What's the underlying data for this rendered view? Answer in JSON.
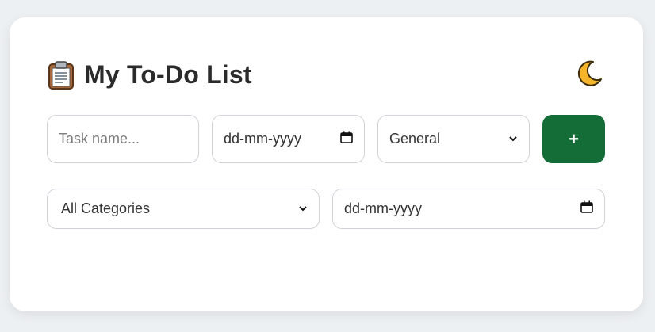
{
  "header": {
    "title": "My To-Do List",
    "title_icon": "clipboard-icon",
    "theme_toggle_icon": "crescent-moon-icon"
  },
  "add_form": {
    "task_name_placeholder": "Task name...",
    "task_name_value": "",
    "due_date_text": "dd-mm-yyyy",
    "category_selected": "General",
    "add_label": "+"
  },
  "filters": {
    "category_selected": "All Categories",
    "date_text": "dd-mm-yyyy"
  },
  "colors": {
    "page_bg": "#edf0f3",
    "card_bg": "#ffffff",
    "accent": "#146c37",
    "border": "#cfd3d7",
    "title": "#2b2b2b"
  }
}
